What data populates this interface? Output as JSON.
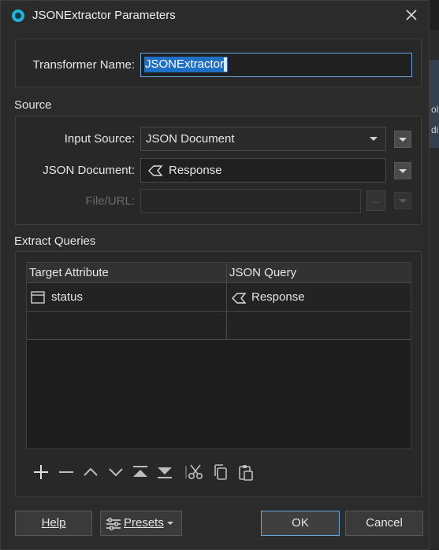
{
  "window": {
    "title": "JSONExtractor Parameters"
  },
  "transformer": {
    "label": "Transformer Name:",
    "value": "JSONExtractor"
  },
  "source": {
    "section_title": "Source",
    "input_source_label": "Input Source:",
    "input_source_value": "JSON Document",
    "json_document_label": "JSON Document:",
    "json_document_value": "Response",
    "file_url_label": "File/URL:",
    "ellipsis_label": "..."
  },
  "extract": {
    "section_title": "Extract Queries",
    "columns": [
      "Target Attribute",
      "JSON Query"
    ],
    "rows": [
      {
        "target": "status",
        "query": "Response"
      }
    ]
  },
  "toolbar": {
    "icons": [
      "add-icon",
      "remove-icon",
      "move-up-icon",
      "move-down-icon",
      "move-top-icon",
      "move-bottom-icon",
      "cut-icon",
      "copy-icon",
      "paste-icon"
    ]
  },
  "buttons": {
    "help": "Help",
    "presets": "Presets",
    "ok": "OK",
    "cancel": "Cancel"
  }
}
